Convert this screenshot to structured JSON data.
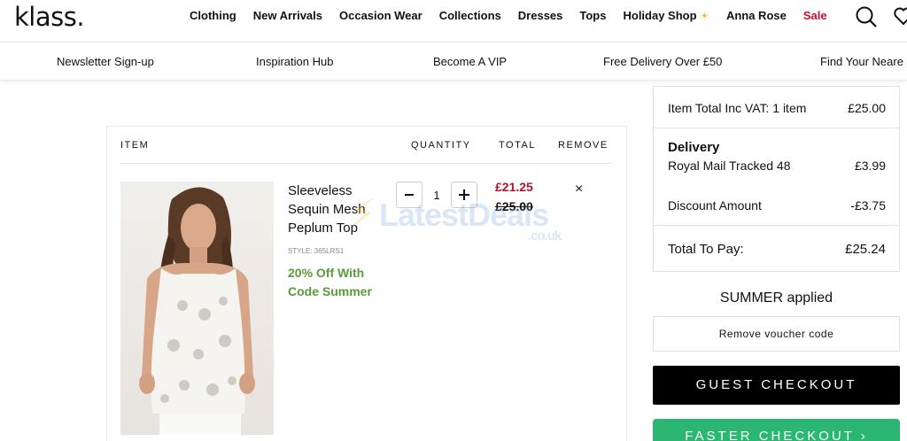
{
  "brand": {
    "logo": "klass."
  },
  "nav": {
    "items": [
      "Clothing",
      "New Arrivals",
      "Occasion Wear",
      "Collections",
      "Dresses",
      "Tops",
      "Holiday Shop",
      "Anna Rose",
      "Sale"
    ],
    "holiday_icon": "☀"
  },
  "subnav": [
    "Newsletter Sign-up",
    "Inspiration Hub",
    "Become A VIP",
    "Free Delivery Over £50",
    "Find Your Neare"
  ],
  "cart": {
    "headers": {
      "item": "ITEM",
      "quantity": "QUANTITY",
      "total": "TOTAL",
      "remove": "REMOVE"
    },
    "product": {
      "name": "Sleeveless Sequin Mesh Peplum Top",
      "style": "STYLE: 365LRS1",
      "promo": "20% Off With Code Summer",
      "quantity": "1",
      "price_now": "£21.25",
      "price_was": "£25.00",
      "remove": "×"
    }
  },
  "watermark": {
    "text": "LatestDeals",
    "suffix": ".co.uk"
  },
  "summary": {
    "item_total_label": "Item Total Inc VAT: 1 item",
    "item_total_value": "£25.00",
    "delivery_heading": "Delivery",
    "delivery_method": "Royal Mail Tracked 48",
    "delivery_value": "£3.99",
    "discount_label": "Discount Amount",
    "discount_value": "-£3.75",
    "total_label": "Total To Pay:",
    "total_value": "£25.24"
  },
  "voucher": {
    "applied": "SUMMER applied",
    "remove": "Remove voucher code"
  },
  "buttons": {
    "guest": "GUEST CHECKOUT",
    "faster": "FASTER CHECKOUT ›"
  },
  "colors": {
    "sale": "#c8102e",
    "price_now": "#a8172b",
    "promo": "#5a9a3a",
    "faster": "#2bb673",
    "guest": "#000000"
  }
}
